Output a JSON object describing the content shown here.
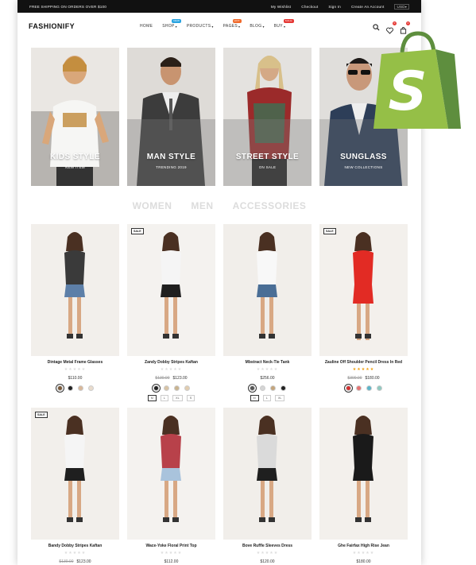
{
  "topbar": {
    "announcement": "FREE SHIPPING ON ORDERS OVER $100",
    "links": [
      "My Wishlist",
      "Checkout",
      "Sign In",
      "Create An Account"
    ],
    "currency": "USD"
  },
  "header": {
    "logo": "FASHIONIFY"
  },
  "nav": [
    {
      "label": "HOME",
      "badge": "",
      "badge_color": ""
    },
    {
      "label": "SHOP",
      "badge": "NEW",
      "badge_color": "#29a3e0"
    },
    {
      "label": "PRODUCTS",
      "badge": "",
      "badge_color": ""
    },
    {
      "label": "PAGES",
      "badge": "HOT",
      "badge_color": "#f06a2b"
    },
    {
      "label": "BLOG",
      "badge": "",
      "badge_color": ""
    },
    {
      "label": "BUY",
      "badge": "SALE",
      "badge_color": "#e53935"
    }
  ],
  "header_counts": {
    "wishlist": "0",
    "cart": "0"
  },
  "categories": [
    {
      "title": "KIDS STYLE",
      "subtitle": "NEW ITEM"
    },
    {
      "title": "MAN STYLE",
      "subtitle": "TRENDING 2019"
    },
    {
      "title": "STREET STYLE",
      "subtitle": "ON SALE"
    },
    {
      "title": "SUNGLASS",
      "subtitle": "NEW COLLECTIONS"
    }
  ],
  "tabs": [
    "WOMEN",
    "MEN",
    "ACCESSORIES"
  ],
  "sale_label": "SALE",
  "products": [
    {
      "name": "Dintage Metal Frame Glasses",
      "old_price": "",
      "price": "$110.00",
      "rating": 0,
      "sale": false,
      "swatches": [
        "#7a5a3a",
        "#222222",
        "#d9b89a",
        "#e9dccd"
      ],
      "sizes": []
    },
    {
      "name": "Zandy Dobby Stripes Kaftan",
      "old_price": "$130.00",
      "price": "$123.00",
      "rating": 0,
      "sale": true,
      "swatches": [
        "#222222",
        "#d8c3a5",
        "#c9b48f",
        "#e2cdb0"
      ],
      "sizes": [
        "M",
        "L",
        "XL",
        "S"
      ]
    },
    {
      "name": "Mbstract Neck-Tie Tank",
      "old_price": "",
      "price": "$256.00",
      "rating": 0,
      "sale": false,
      "swatches": [
        "#555555",
        "#d5d5d5",
        "#c4a57c",
        "#222222"
      ],
      "sizes": [
        "M",
        "L",
        "XL"
      ]
    },
    {
      "name": "Zauline Off Shoulder Pencil Dress In Red",
      "old_price": "$300.00",
      "price": "$180.00",
      "rating": 5,
      "sale": true,
      "swatches": [
        "#d32f2f",
        "#e57373",
        "#5bb5c9",
        "#8fc9c0"
      ],
      "sizes": []
    },
    {
      "name": "Bandy Dobby Stripes Kaftan",
      "old_price": "$130.00",
      "price": "$123.00",
      "rating": 0,
      "sale": true,
      "swatches": [],
      "sizes": []
    },
    {
      "name": "Wace-Yoke Floral Print Top",
      "old_price": "",
      "price": "$112.00",
      "rating": 0,
      "sale": false,
      "swatches": [],
      "sizes": []
    },
    {
      "name": "Bove Ruffle Sleeves Dress",
      "old_price": "",
      "price": "$120.00",
      "rating": 0,
      "sale": false,
      "swatches": [],
      "sizes": []
    },
    {
      "name": "Ghe Fairfax High Rise Jean",
      "old_price": "",
      "price": "$180.00",
      "rating": 0,
      "sale": false,
      "swatches": [],
      "sizes": []
    }
  ],
  "colors": {
    "topbar": "#111111",
    "bag_green": "#95bf47",
    "bag_dark": "#5e8e3e",
    "star": "#f2a00c"
  }
}
